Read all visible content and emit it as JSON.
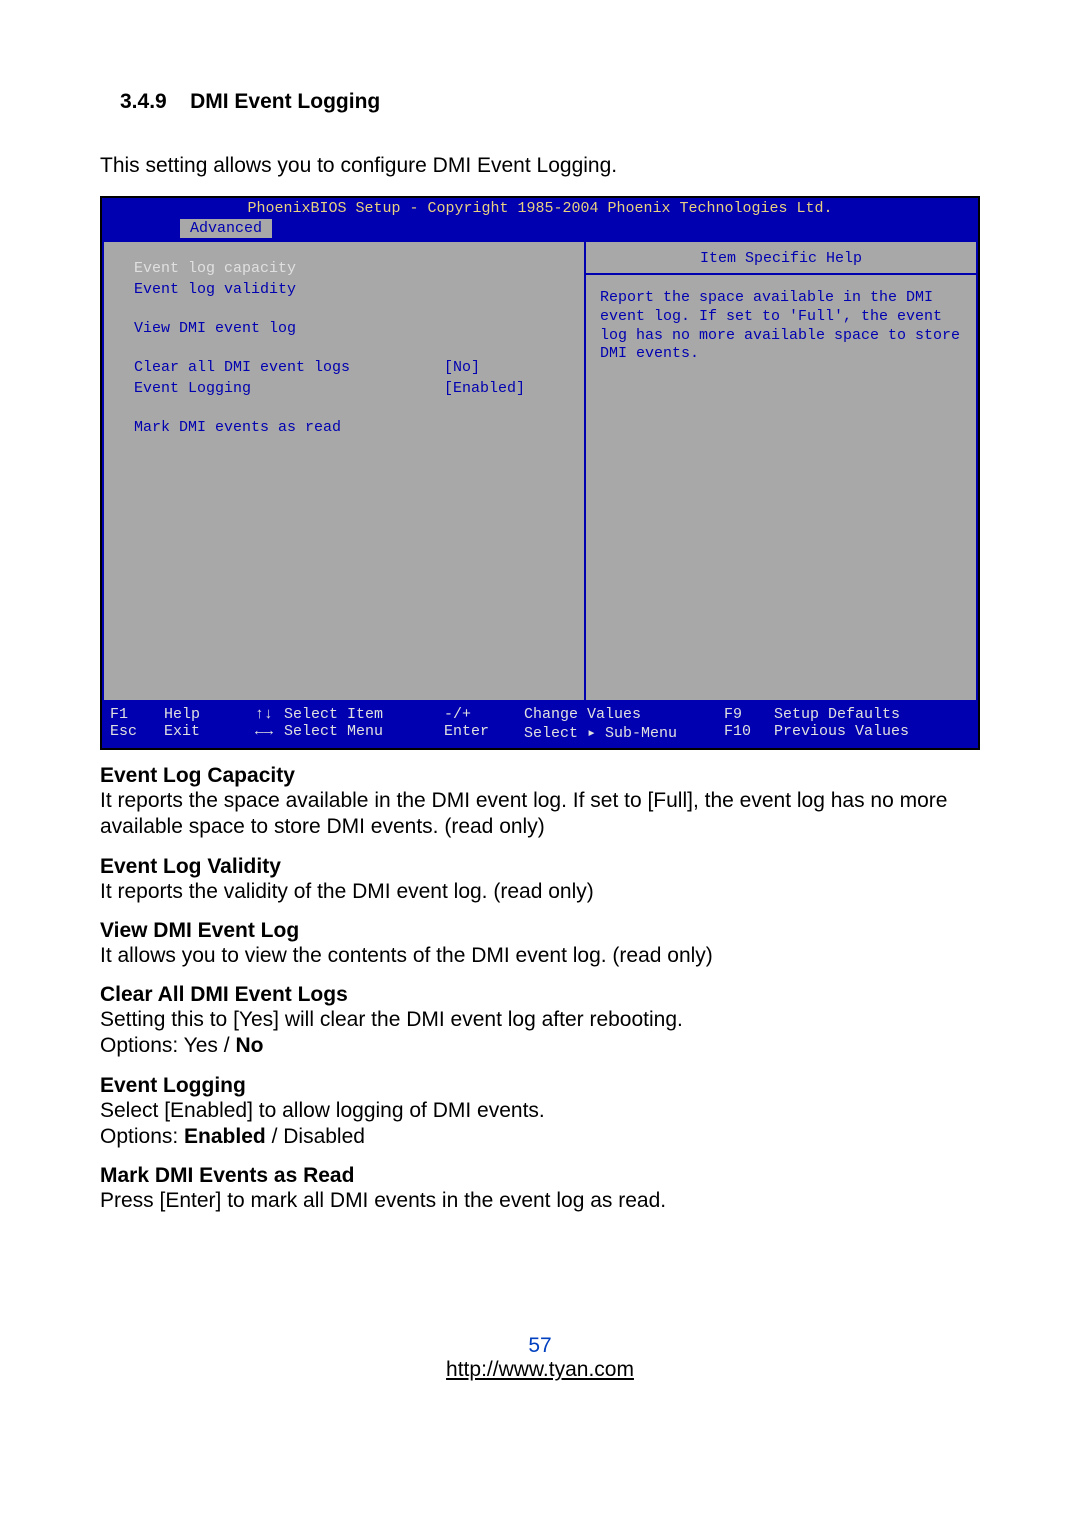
{
  "section_number": "3.4.9",
  "section_title": "DMI Event Logging",
  "intro": "This setting allows you to configure DMI Event Logging.",
  "bios": {
    "title": "PhoenixBIOS Setup - Copyright 1985-2004 Phoenix Technologies Ltd.",
    "tab": "Advanced",
    "items": {
      "capacity_label": "Event log capacity",
      "validity_label": "Event log validity",
      "view_label": "View DMI event log",
      "clear_label": "Clear all DMI event logs",
      "clear_value": "[No]",
      "logging_label": "Event Logging",
      "logging_value": "[Enabled]",
      "mark_label": "Mark DMI events as read"
    },
    "help_title": "Item Specific Help",
    "help_text": "Report the space available in the DMI event log.  If set to 'Full', the event log has no more available space to store DMI events.",
    "footer": {
      "f1": "F1",
      "help": "Help",
      "updown": "↑↓",
      "select_item": "Select Item",
      "pm": "-/+",
      "change_values": "Change Values",
      "f9": "F9",
      "setup_defaults": "Setup Defaults",
      "esc": "Esc",
      "exit": "Exit",
      "lr": "←→",
      "select_menu": "Select Menu",
      "enter": "Enter",
      "select_sub": "Select ▸ Sub-Menu",
      "f10": "F10",
      "prev_values": "Previous Values"
    }
  },
  "text": {
    "cap_h": "Event Log Capacity",
    "cap_b": "It reports the space available in the DMI event log.  If set to [Full], the event log has no more available space to store DMI events. (read only)",
    "val_h": "Event Log Validity",
    "val_b": "It reports the validity of the DMI event log. (read only)",
    "view_h": "View DMI Event Log",
    "view_b": "It allows you to view the contents of the DMI event log. (read only)",
    "clear_h": "Clear All DMI Event Logs",
    "clear_b1": "Setting this to [Yes] will clear the DMI event log after rebooting.",
    "clear_opt_pre": "Options: Yes / ",
    "clear_opt_bold": "No",
    "log_h": "Event Logging",
    "log_b1": "Select [Enabled] to allow logging of DMI events.",
    "log_opt_pre": "Options: ",
    "log_opt_bold": "Enabled",
    "log_opt_post": " / Disabled",
    "mark_h": "Mark DMI Events as Read",
    "mark_b": "Press [Enter] to mark all DMI events in the event log as read."
  },
  "page_number": "57",
  "footer_url": "http://www.tyan.com"
}
